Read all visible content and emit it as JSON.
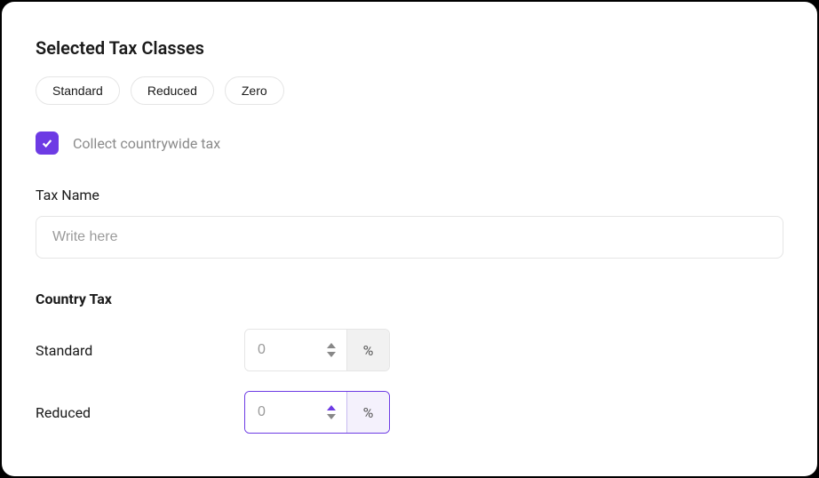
{
  "header": {
    "title": "Selected Tax Classes"
  },
  "chips": [
    {
      "label": "Standard"
    },
    {
      "label": "Reduced"
    },
    {
      "label": "Zero"
    }
  ],
  "collect_checkbox": {
    "label": "Collect countrywide tax",
    "checked": true
  },
  "tax_name": {
    "label": "Tax Name",
    "placeholder": "Write here",
    "value": ""
  },
  "country_tax": {
    "title": "Country Tax",
    "rows": [
      {
        "label": "Standard",
        "value": "0",
        "unit": "%",
        "focused": false
      },
      {
        "label": "Reduced",
        "value": "0",
        "unit": "%",
        "focused": true
      }
    ]
  }
}
